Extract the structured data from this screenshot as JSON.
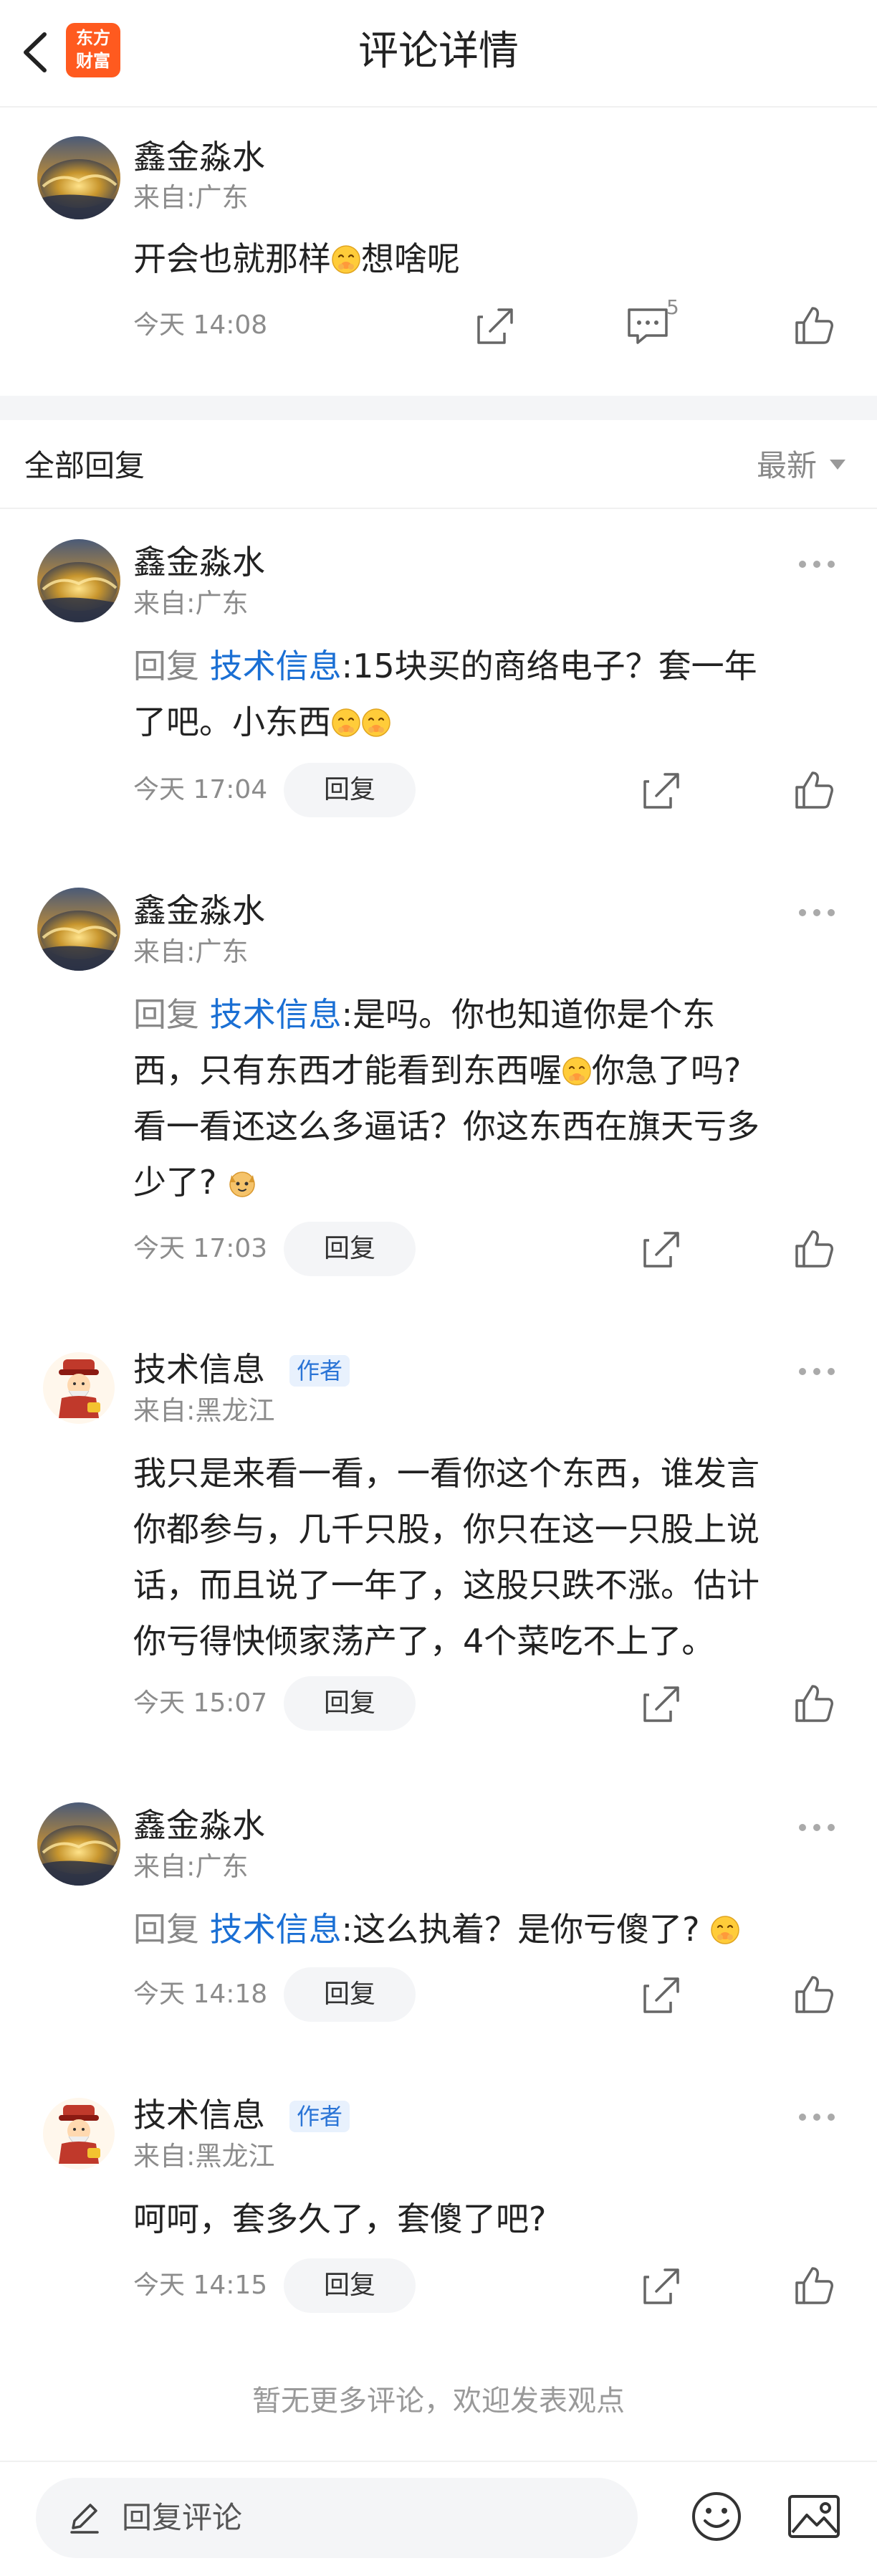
{
  "header": {
    "title": "评论详情",
    "logo_line1": "东方",
    "logo_line2": "财富"
  },
  "main_comment": {
    "user": "鑫金淼水",
    "location": "来自:广东",
    "text_before": "开会也就那样",
    "text_after": "想啥呢",
    "time": "今天 14:08",
    "comment_count": "5"
  },
  "section": {
    "title": "全部回复",
    "sort": "最新"
  },
  "reply_label": "回复",
  "replies": [
    {
      "user": "鑫金淼水",
      "location": "来自:广东",
      "reply_prefix": "回复",
      "mention": "技术信息",
      "line1": ":15块买的商络电子？套一年",
      "line2": "了吧。小东西",
      "time": "今天 17:04"
    },
    {
      "user": "鑫金淼水",
      "location": "来自:广东",
      "reply_prefix": "回复",
      "mention": "技术信息",
      "line1": ":是吗。你也知道你是个东",
      "line2a": "西，只有东西才能看到东西喔",
      "line2b": "你急了吗?",
      "line3": "看一看还这么多逼话？你这东西在旗天亏多",
      "line4": "少了?",
      "time": "今天 17:03"
    },
    {
      "user": "技术信息",
      "badge": "作者",
      "location": "来自:黑龙江",
      "line1": "我只是来看一看，一看你这个东西，谁发言",
      "line2": "你都参与，几千只股，你只在这一只股上说",
      "line3": "话，而且说了一年了，这股只跌不涨。估计",
      "line4": "你亏得快倾家荡产了，4个菜吃不上了。",
      "time": "今天 15:07"
    },
    {
      "user": "鑫金淼水",
      "location": "来自:广东",
      "reply_prefix": "回复",
      "mention": "技术信息",
      "line1": ":这么执着？是你亏傻了?",
      "time": "今天 14:18"
    },
    {
      "user": "技术信息",
      "badge": "作者",
      "location": "来自:黑龙江",
      "line1": "呵呵，套多久了，套傻了吧?",
      "time": "今天 14:15"
    }
  ],
  "footer_note": "暂无更多评论，欢迎发表观点",
  "bottom": {
    "input_placeholder": "回复评论"
  }
}
